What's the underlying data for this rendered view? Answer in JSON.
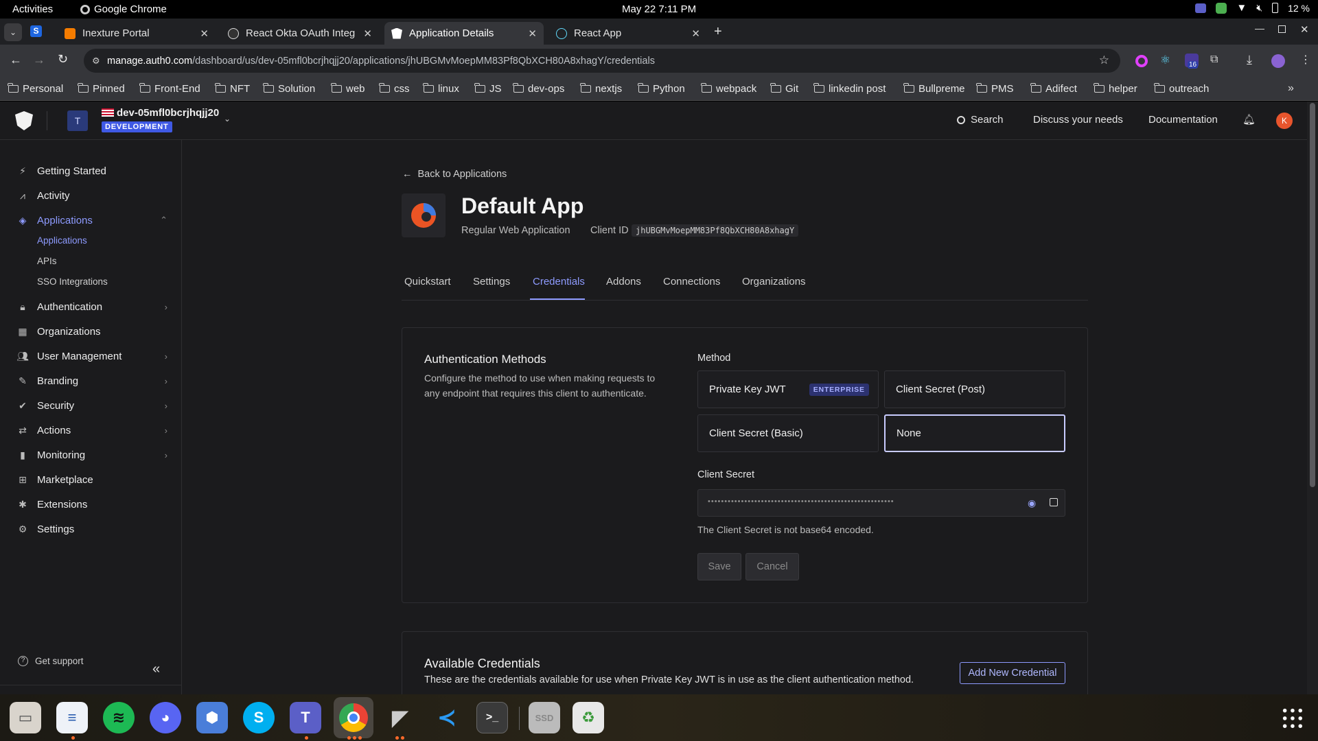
{
  "system": {
    "activities": "Activities",
    "app_name": "Google Chrome",
    "clock": "May 22  7:11 PM",
    "battery": "12 %",
    "extension_badge": "16"
  },
  "browser": {
    "tabs": [
      {
        "title": "Inexture Portal",
        "favicon_color": "#f57c00",
        "active": false
      },
      {
        "title": "React Okta OAuth Integ",
        "favicon_color": "#dcdcdc",
        "active": false
      },
      {
        "title": "Application Details",
        "favicon_color": "#ffffff",
        "active": true
      },
      {
        "title": "React App",
        "favicon_color": "#61dafb",
        "active": false
      }
    ],
    "url_host": "manage.auth0.com",
    "url_path": "/dashboard/us/dev-05mfl0bcrjhqjj20/applications/jhUBGMvMoepMM83Pf8QbXCH80A8xhagY/credentials",
    "bookmarks": [
      "Personal",
      "Pinned",
      "Front-End",
      "NFT",
      "Solution",
      "web",
      "css",
      "linux",
      "JS",
      "dev-ops",
      "nextjs",
      "Python",
      "webpack",
      "Git",
      "linkedin post",
      "Bullpreme",
      "PMS",
      "Adifect",
      "helper",
      "outreach"
    ]
  },
  "header": {
    "tenant_initial": "T",
    "tenant_name": "dev-05mfl0bcrjhqjj20",
    "env_badge": "DEVELOPMENT",
    "search": "Search",
    "discuss": "Discuss your needs",
    "docs": "Documentation",
    "avatar_initial": "K"
  },
  "sidebar": {
    "items": [
      {
        "label": "Getting Started",
        "icon": "bolt-icon"
      },
      {
        "label": "Activity",
        "icon": "chart-line-icon"
      },
      {
        "label": "Applications",
        "icon": "layers-icon"
      },
      {
        "label": "Authentication",
        "icon": "lock-icon"
      },
      {
        "label": "Organizations",
        "icon": "building-icon"
      },
      {
        "label": "User Management",
        "icon": "users-icon"
      },
      {
        "label": "Branding",
        "icon": "brush-icon"
      },
      {
        "label": "Security",
        "icon": "shield-check-icon"
      },
      {
        "label": "Actions",
        "icon": "actions-icon"
      },
      {
        "label": "Monitoring",
        "icon": "bar-chart-icon"
      },
      {
        "label": "Marketplace",
        "icon": "marketplace-icon"
      },
      {
        "label": "Extensions",
        "icon": "extensions-icon"
      },
      {
        "label": "Settings",
        "icon": "gear-icon"
      }
    ],
    "subitems": [
      "Applications",
      "APIs",
      "SSO Integrations"
    ],
    "support": "Get support"
  },
  "app": {
    "back": "Back to Applications",
    "name": "Default App",
    "type": "Regular Web Application",
    "client_id_label": "Client ID",
    "client_id": "jhUBGMvMoepMM83Pf8QbXCH80A8xhagY",
    "tabs": [
      "Quickstart",
      "Settings",
      "Credentials",
      "Addons",
      "Connections",
      "Organizations"
    ],
    "active_tab": "Credentials"
  },
  "auth_methods": {
    "title": "Authentication Methods",
    "description": "Configure the method to use when making requests to any endpoint that requires this client to authenticate.",
    "method_label": "Method",
    "options": [
      {
        "label": "Private Key JWT",
        "badge": "ENTERPRISE",
        "selected": false
      },
      {
        "label": "Client Secret (Post)",
        "selected": false
      },
      {
        "label": "Client Secret (Basic)",
        "selected": false
      },
      {
        "label": "None",
        "selected": true
      }
    ],
    "secret_label": "Client Secret",
    "secret_masked": "••••••••••••••••••••••••••••••••••••••••••••••••••••••••",
    "secret_hint": "The Client Secret is not base64 encoded.",
    "save": "Save",
    "cancel": "Cancel"
  },
  "available_credentials": {
    "title": "Available Credentials",
    "description": "These are the credentials available for use when Private Key JWT is in use as the client authentication method.",
    "add_button": "Add New Credential"
  },
  "colors": {
    "accent": "#8e9bff",
    "env_badge": "#3f59e4",
    "avatar": "#e8552d"
  }
}
